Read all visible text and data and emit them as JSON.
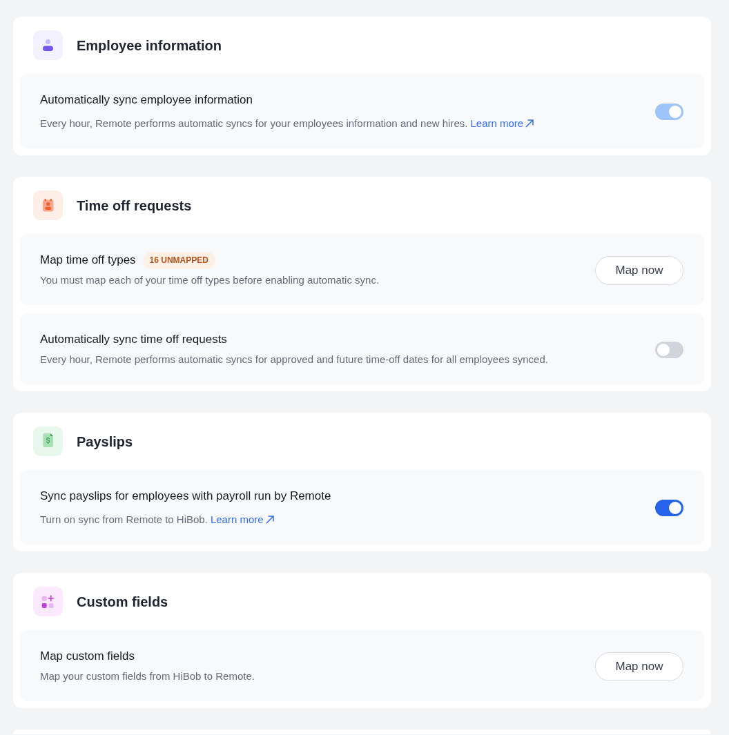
{
  "sections": [
    {
      "kind": "people",
      "title": "Employee information",
      "rows": [
        {
          "kind": "toggle",
          "title": "Automatically sync employee information",
          "description": "Every hour, Remote performs automatic syncs for your employees information and new hires.",
          "link": "Learn more",
          "on": true,
          "disabled": true
        }
      ]
    },
    {
      "kind": "leave",
      "title": "Time off requests",
      "rows": [
        {
          "kind": "action",
          "title": "Map time off types",
          "badge": "16 UNMAPPED",
          "description": "You must map each of your time off types before enabling automatic sync.",
          "button": "Map now"
        },
        {
          "kind": "toggle",
          "title": "Automatically sync time off requests",
          "description": "Every hour, Remote performs automatic syncs for approved and future time-off dates for all employees synced.",
          "on": false,
          "disabled": false
        }
      ]
    },
    {
      "kind": "payroll",
      "title": "Payslips",
      "rows": [
        {
          "kind": "toggle",
          "title": "Sync payslips for employees with payroll run by Remote",
          "description": "Turn on sync from Remote to HiBob.",
          "link": "Learn more",
          "on": true,
          "disabled": false
        }
      ]
    },
    {
      "kind": "fields",
      "title": "Custom fields",
      "rows": [
        {
          "kind": "action",
          "title": "Map custom fields",
          "description": "Map your custom fields from HiBob to Remote.",
          "button": "Map now"
        }
      ]
    }
  ]
}
